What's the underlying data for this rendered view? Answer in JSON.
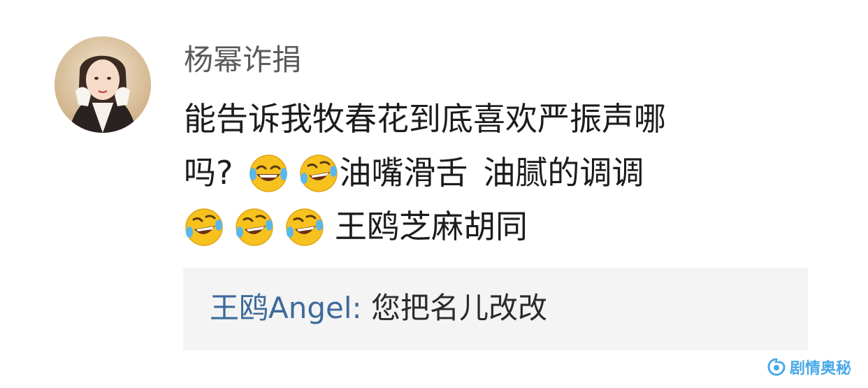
{
  "comment": {
    "username": "杨幂诈捐",
    "line1": "能告诉我牧春花到底喜欢严振声哪",
    "line2_prefix": "吗?",
    "line2_text_a": "油嘴滑舌",
    "line2_text_b": "油腻的调调",
    "line3_text": "王鸥芝麻胡同",
    "emojis": [
      "laughing-tears-emoji",
      "crying-laughing-emoji",
      "crying-laughing-emoji",
      "crying-laughing-emoji",
      "crying-laughing-emoji"
    ]
  },
  "reply": {
    "user": "王鸥Angel:",
    "text": " 您把名儿改改"
  },
  "watermark": {
    "text": "剧情奥秘",
    "color": "#4aa8ea"
  },
  "colors": {
    "username": "#5a5a5a",
    "reply_user": "#3d6a9a",
    "reply_bg": "#f4f4f4"
  }
}
